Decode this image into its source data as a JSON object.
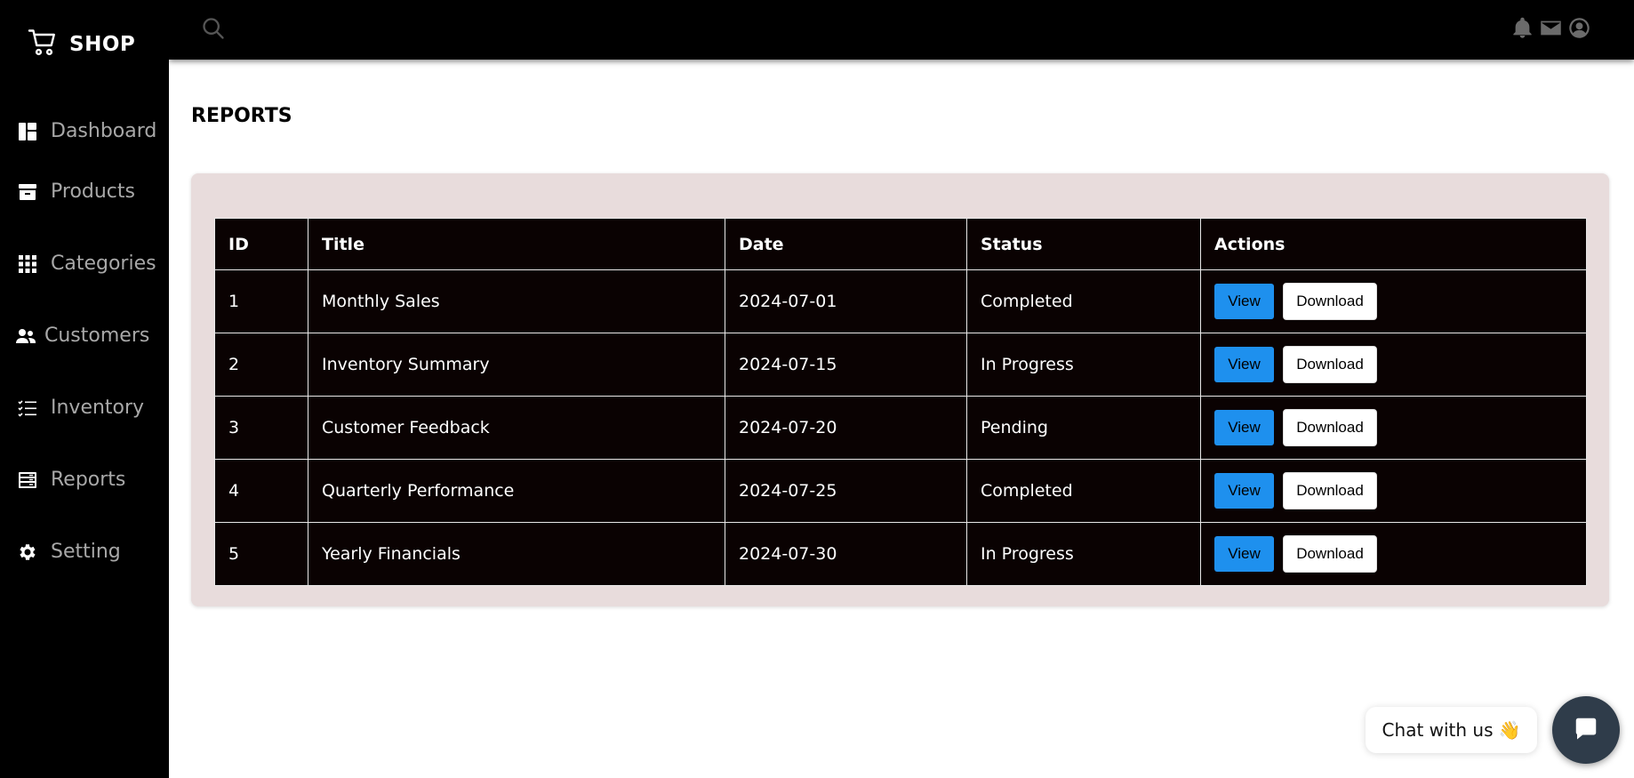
{
  "brand": {
    "name": "SHOP",
    "icon": "cart-icon"
  },
  "sidebar": {
    "items": [
      {
        "label": "Dashboard",
        "icon": "dashboard-icon"
      },
      {
        "label": "Products",
        "icon": "archive-icon"
      },
      {
        "label": "Categories",
        "icon": "grid-icon"
      },
      {
        "label": "Customers",
        "icon": "users-icon"
      },
      {
        "label": "Inventory",
        "icon": "list-icon"
      },
      {
        "label": "Reports",
        "icon": "reports-icon"
      },
      {
        "label": "Setting",
        "icon": "gear-icon"
      }
    ]
  },
  "topbar": {
    "icons": [
      "search-icon",
      "bell-icon",
      "mail-icon",
      "account-icon"
    ]
  },
  "page": {
    "title": "REPORTS"
  },
  "table": {
    "headers": [
      "ID",
      "Title",
      "Date",
      "Status",
      "Actions"
    ],
    "rows": [
      {
        "id": "1",
        "title": "Monthly Sales",
        "date": "2024-07-01",
        "status": "Completed"
      },
      {
        "id": "2",
        "title": "Inventory Summary",
        "date": "2024-07-15",
        "status": "In Progress"
      },
      {
        "id": "3",
        "title": "Customer Feedback",
        "date": "2024-07-20",
        "status": "Pending"
      },
      {
        "id": "4",
        "title": "Quarterly Performance",
        "date": "2024-07-25",
        "status": "Completed"
      },
      {
        "id": "5",
        "title": "Yearly Financials",
        "date": "2024-07-30",
        "status": "In Progress"
      }
    ],
    "actions": {
      "view_label": "View",
      "download_label": "Download"
    }
  },
  "chat": {
    "label": "Chat with us",
    "emoji": "👋"
  },
  "colors": {
    "sidebar_bg": "#000000",
    "panel_bg": "#e8dcdc",
    "table_bg": "#0a0202",
    "view_button": "#1e90ee",
    "chat_bubble": "#2f3c4a"
  }
}
